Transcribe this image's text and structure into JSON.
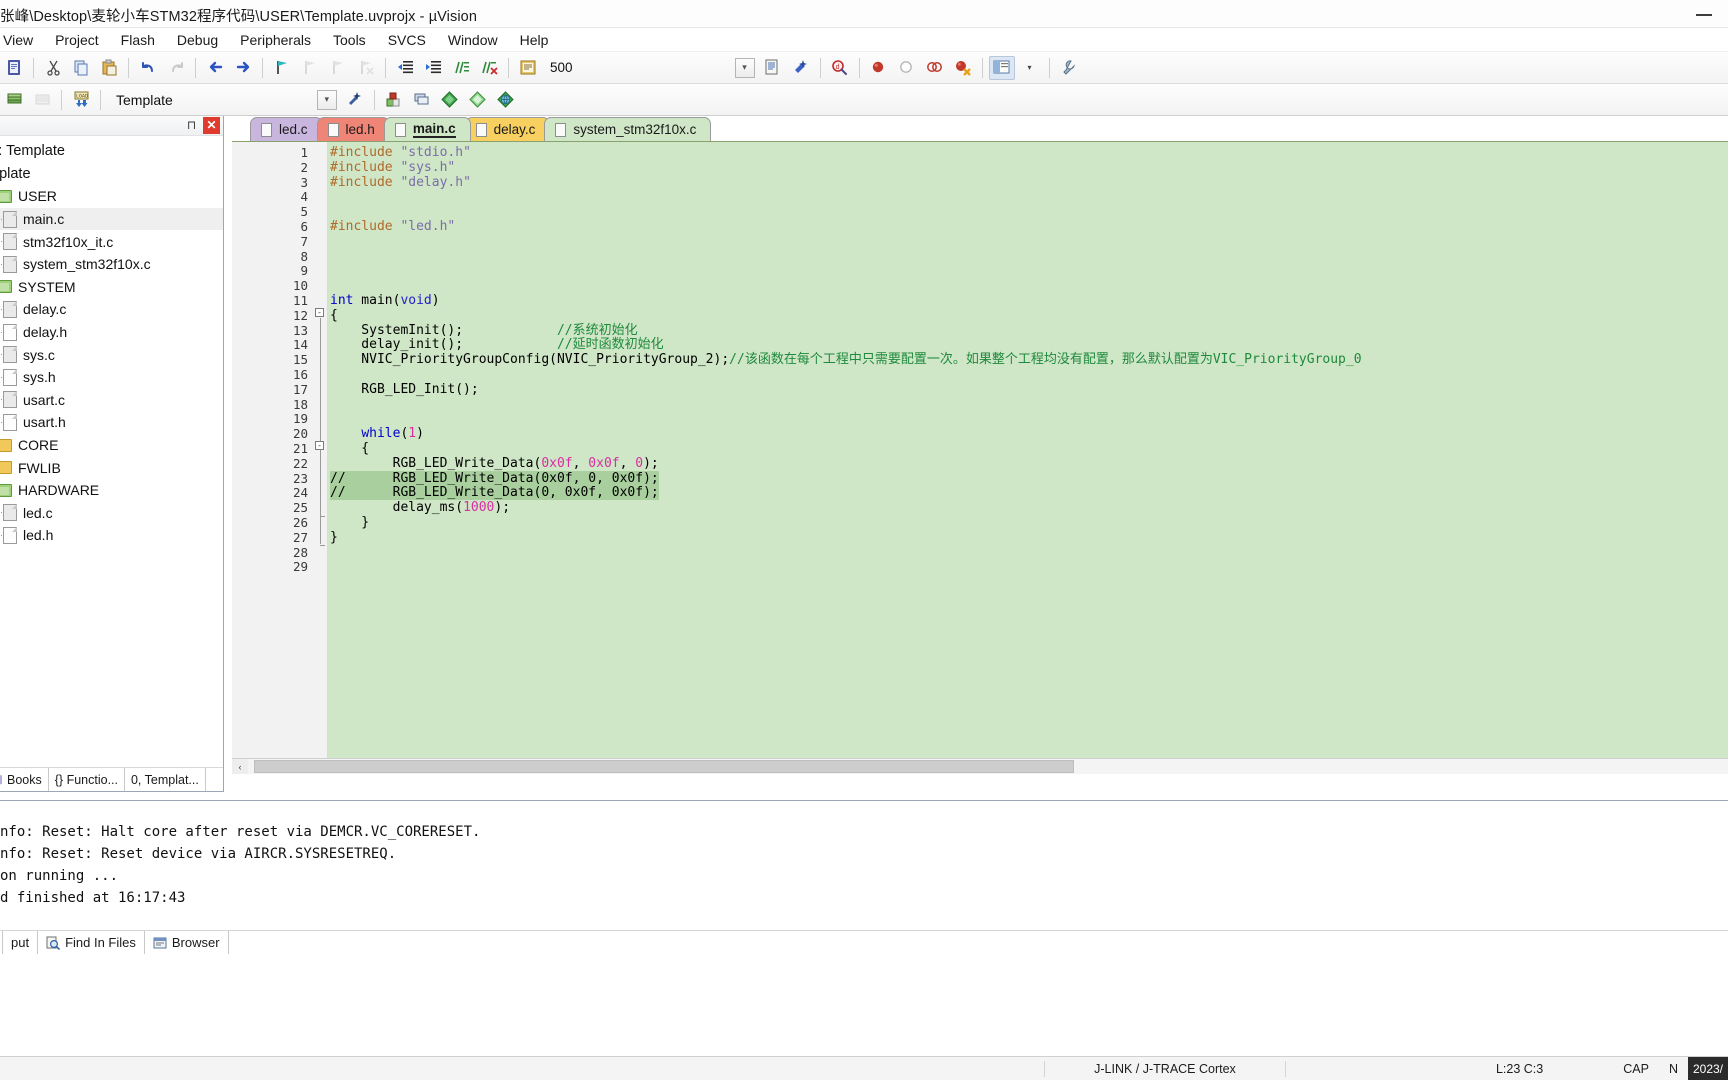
{
  "window": {
    "title": "张峰\\Desktop\\麦轮小车STM32程序代码\\USER\\Template.uvprojx - µVision",
    "minimize_label": "—"
  },
  "menu": {
    "items": [
      "View",
      "Project",
      "Flash",
      "Debug",
      "Peripherals",
      "Tools",
      "SVCS",
      "Window",
      "Help"
    ]
  },
  "toolbar": {
    "memory_value": "500",
    "target_name": "Template",
    "combo_placeholder": ""
  },
  "project_panel": {
    "caption_pin": "⊓",
    "caption_close": "✕",
    "root_label": "ct: Template",
    "target_label": "mplate",
    "tree": [
      {
        "label": "USER",
        "type": "group",
        "depth": 1,
        "selected": false
      },
      {
        "label": "main.c",
        "type": "file",
        "depth": 2,
        "selected": true
      },
      {
        "label": "stm32f10x_it.c",
        "type": "file",
        "depth": 2,
        "selected": false
      },
      {
        "label": "system_stm32f10x.c",
        "type": "file",
        "depth": 2,
        "selected": false
      },
      {
        "label": "SYSTEM",
        "type": "group",
        "depth": 1,
        "selected": false
      },
      {
        "label": "delay.c",
        "type": "file",
        "depth": 2,
        "selected": false
      },
      {
        "label": "delay.h",
        "type": "file-plain",
        "depth": 2,
        "selected": false
      },
      {
        "label": "sys.c",
        "type": "file",
        "depth": 2,
        "selected": false
      },
      {
        "label": "sys.h",
        "type": "file-plain",
        "depth": 2,
        "selected": false
      },
      {
        "label": "usart.c",
        "type": "file",
        "depth": 2,
        "selected": false
      },
      {
        "label": "usart.h",
        "type": "file-plain",
        "depth": 2,
        "selected": false
      },
      {
        "label": "CORE",
        "type": "group-yellow",
        "depth": 1,
        "selected": false
      },
      {
        "label": "FWLIB",
        "type": "group-yellow",
        "depth": 1,
        "selected": false
      },
      {
        "label": "HARDWARE",
        "type": "group",
        "depth": 1,
        "selected": false
      },
      {
        "label": "led.c",
        "type": "file",
        "depth": 2,
        "selected": false
      },
      {
        "label": "led.h",
        "type": "file-plain",
        "depth": 2,
        "selected": false
      }
    ],
    "tabs": [
      {
        "label": "Books",
        "icon": "books-icon"
      },
      {
        "label": "{} Functio...",
        "icon": "functions-icon"
      },
      {
        "label": "0, Templat...",
        "icon": "templates-icon"
      }
    ]
  },
  "editor": {
    "tabs": [
      {
        "label": "led.c",
        "color": "#c9b6de",
        "active": false
      },
      {
        "label": "led.h",
        "color": "#ef8577",
        "active": false
      },
      {
        "label": "main.c",
        "color": "#cfe6c7",
        "active": true
      },
      {
        "label": "delay.c",
        "color": "#f7d060",
        "active": false
      },
      {
        "label": "system_stm32f10x.c",
        "color": "#cfe6c7",
        "active": false
      }
    ],
    "first_line": 1,
    "last_line": 29,
    "lines": [
      {
        "n": 1,
        "tokens": [
          {
            "t": "#include ",
            "c": "pp"
          },
          {
            "t": "\"stdio.h\"",
            "c": "str"
          }
        ]
      },
      {
        "n": 2,
        "tokens": [
          {
            "t": "#include ",
            "c": "pp"
          },
          {
            "t": "\"sys.h\"",
            "c": "str"
          }
        ]
      },
      {
        "n": 3,
        "tokens": [
          {
            "t": "#include ",
            "c": "pp"
          },
          {
            "t": "\"delay.h\"",
            "c": "str"
          }
        ]
      },
      {
        "n": 4,
        "tokens": []
      },
      {
        "n": 5,
        "tokens": []
      },
      {
        "n": 6,
        "tokens": [
          {
            "t": "#include ",
            "c": "pp"
          },
          {
            "t": "\"led.h\"",
            "c": "str"
          }
        ]
      },
      {
        "n": 7,
        "tokens": []
      },
      {
        "n": 8,
        "tokens": []
      },
      {
        "n": 9,
        "tokens": []
      },
      {
        "n": 10,
        "tokens": []
      },
      {
        "n": 11,
        "tokens": [
          {
            "t": "int",
            "c": "kw"
          },
          {
            "t": " main(",
            "c": ""
          },
          {
            "t": "void",
            "c": "kw2"
          },
          {
            "t": ")",
            "c": ""
          }
        ]
      },
      {
        "n": 12,
        "tokens": [
          {
            "t": "{",
            "c": ""
          }
        ]
      },
      {
        "n": 13,
        "tokens": [
          {
            "t": "    SystemInit();            ",
            "c": ""
          },
          {
            "t": "//系统初始化",
            "c": "cmt"
          }
        ]
      },
      {
        "n": 14,
        "tokens": [
          {
            "t": "    delay_init();            ",
            "c": ""
          },
          {
            "t": "//延时函数初始化",
            "c": "cmt"
          }
        ]
      },
      {
        "n": 15,
        "tokens": [
          {
            "t": "    NVIC_PriorityGroupConfig(NVIC_PriorityGroup_2);",
            "c": ""
          },
          {
            "t": "//该函数在每个工程中只需要配置一次。如果整个工程均没有配置，那么默认配置为VIC_PriorityGroup_0",
            "c": "cmt"
          }
        ]
      },
      {
        "n": 16,
        "tokens": []
      },
      {
        "n": 17,
        "tokens": [
          {
            "t": "    RGB_LED_Init();",
            "c": ""
          }
        ]
      },
      {
        "n": 18,
        "tokens": []
      },
      {
        "n": 19,
        "tokens": []
      },
      {
        "n": 20,
        "tokens": [
          {
            "t": "    ",
            "c": ""
          },
          {
            "t": "while",
            "c": "kw"
          },
          {
            "t": "(",
            "c": ""
          },
          {
            "t": "1",
            "c": "num"
          },
          {
            "t": ")",
            "c": ""
          }
        ]
      },
      {
        "n": 21,
        "tokens": [
          {
            "t": "    {",
            "c": ""
          }
        ]
      },
      {
        "n": 22,
        "tokens": [
          {
            "t": "        RGB_LED_Write_Data(",
            "c": ""
          },
          {
            "t": "0x0f",
            "c": "num"
          },
          {
            "t": ", ",
            "c": ""
          },
          {
            "t": "0x0f",
            "c": "num"
          },
          {
            "t": ", ",
            "c": ""
          },
          {
            "t": "0",
            "c": "num"
          },
          {
            "t": ");",
            "c": ""
          }
        ]
      },
      {
        "n": 23,
        "tokens": [
          {
            "t": "//      RGB_LED_Write_Data(0x0f, 0, 0x0f);",
            "c": ""
          }
        ],
        "selected": true
      },
      {
        "n": 24,
        "tokens": [
          {
            "t": "//      RGB_LED_Write_Data(0, 0x0f, 0x0f);",
            "c": ""
          }
        ],
        "selected": true
      },
      {
        "n": 25,
        "tokens": [
          {
            "t": "        delay_ms(",
            "c": ""
          },
          {
            "t": "1000",
            "c": "num"
          },
          {
            "t": ");",
            "c": ""
          }
        ]
      },
      {
        "n": 26,
        "tokens": [
          {
            "t": "    }",
            "c": ""
          }
        ]
      },
      {
        "n": 27,
        "tokens": [
          {
            "t": "}",
            "c": ""
          }
        ]
      },
      {
        "n": 28,
        "tokens": []
      },
      {
        "n": 29,
        "tokens": []
      }
    ],
    "scroll_left_arrow": "‹"
  },
  "build_output": {
    "lines": [
      "nfo: Reset: Halt core after reset via DEMCR.VC_CORERESET.",
      "nfo: Reset: Reset device via AIRCR.SYSRESETREQ.",
      "on running ...",
      "d finished at 16:17:43"
    ]
  },
  "bottom_tabs": [
    {
      "label": "Find In Files",
      "icon": "find-in-files-icon"
    },
    {
      "label": "Browser",
      "icon": "browser-icon"
    }
  ],
  "status_bar": {
    "output_label": "put",
    "debugger": "J-LINK / J-TRACE Cortex",
    "cursor": "L:23 C:3",
    "caps": "CAP",
    "num": "N",
    "clock": "2023/"
  },
  "colors": {
    "code_background": "#cfe6c7",
    "selection": "#a8cf9d",
    "comment": "#1f8a3d",
    "keyword": "#0000cd",
    "number": "#d62fa0",
    "string": "#7a6ea8",
    "preprocessor": "#b06a2a"
  }
}
